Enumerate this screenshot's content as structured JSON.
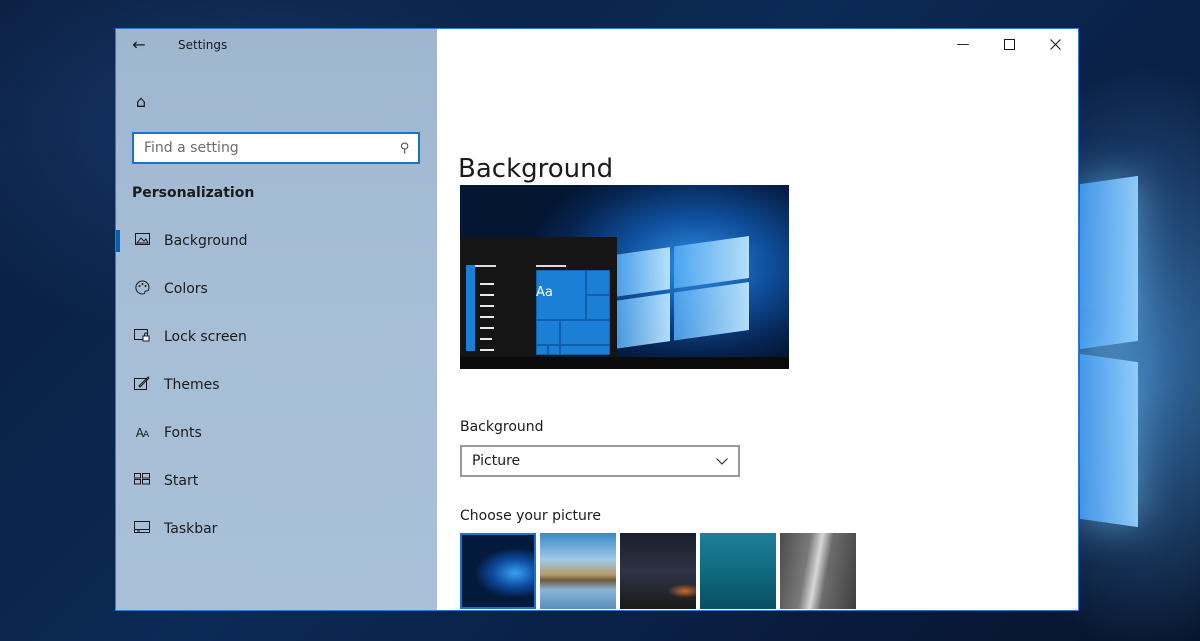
{
  "window": {
    "title": "Settings"
  },
  "titlebar": {
    "back_icon": "back-arrow-icon",
    "home_icon": "home-icon"
  },
  "search": {
    "placeholder": "Find a setting",
    "icon": "search-icon"
  },
  "sidebar": {
    "section": "Personalization",
    "items": [
      {
        "label": "Background",
        "icon": "picture-icon",
        "active": true
      },
      {
        "label": "Colors",
        "icon": "palette-icon",
        "active": false
      },
      {
        "label": "Lock screen",
        "icon": "lock-screen-icon",
        "active": false
      },
      {
        "label": "Themes",
        "icon": "themes-icon",
        "active": false
      },
      {
        "label": "Fonts",
        "icon": "fonts-icon",
        "active": false
      },
      {
        "label": "Start",
        "icon": "start-icon",
        "active": false
      },
      {
        "label": "Taskbar",
        "icon": "taskbar-icon",
        "active": false
      }
    ]
  },
  "main": {
    "title": "Background",
    "preview": {
      "sample_text": "Aa"
    },
    "background_field": {
      "label": "Background",
      "selected": "Picture"
    },
    "picture_section": {
      "label": "Choose your picture",
      "thumbnails": [
        "windows-logo-wallpaper",
        "beach-rocks-wallpaper",
        "night-sky-tent-wallpaper",
        "underwater-swimmer-wallpaper",
        "rock-cliff-wallpaper"
      ]
    }
  },
  "colors": {
    "accent": "#0063b1",
    "focus_border": "#1a73c9",
    "sidebar_bg": "#a6bdd6",
    "desktop_bg": "#0b2a55"
  }
}
